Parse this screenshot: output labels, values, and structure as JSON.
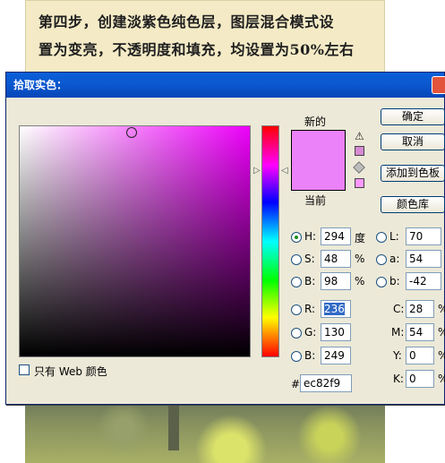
{
  "banner": {
    "line1": "第四步，创建淡紫色纯色层，图层混合模式设",
    "line2": "置为变亮，不透明度和填充，均设置为50%左右"
  },
  "dialog": {
    "title": "拾取实色：",
    "new_label": "新的",
    "current_label": "当前",
    "new_color": "#ec82f9",
    "buttons": {
      "ok": "确定",
      "cancel": "取消",
      "add_swatch": "添加到色板",
      "color_library": "颜色库"
    },
    "hsb": {
      "h_label": "H:",
      "h_value": "294",
      "h_unit": "度",
      "s_label": "S:",
      "s_value": "48",
      "s_unit": "%",
      "b_label": "B:",
      "b_value": "98",
      "b_unit": "%"
    },
    "rgb": {
      "r_label": "R:",
      "r_value": "236",
      "g_label": "G:",
      "g_value": "130",
      "b_label": "B:",
      "b_value": "249"
    },
    "lab": {
      "l_label": "L:",
      "l_value": "70",
      "a_label": "a:",
      "a_value": "54",
      "b_label": "b:",
      "b_value": "-42"
    },
    "cmyk": {
      "c_label": "C:",
      "c_value": "28",
      "c_unit": "%",
      "m_label": "M:",
      "m_value": "54",
      "m_unit": "%",
      "y_label": "Y:",
      "y_value": "0",
      "y_unit": "%",
      "k_label": "K:",
      "k_value": "0",
      "k_unit": "%"
    },
    "hex": {
      "label": "#",
      "value": "ec82f9"
    },
    "web_only_label": "只有 Web 颜色"
  }
}
